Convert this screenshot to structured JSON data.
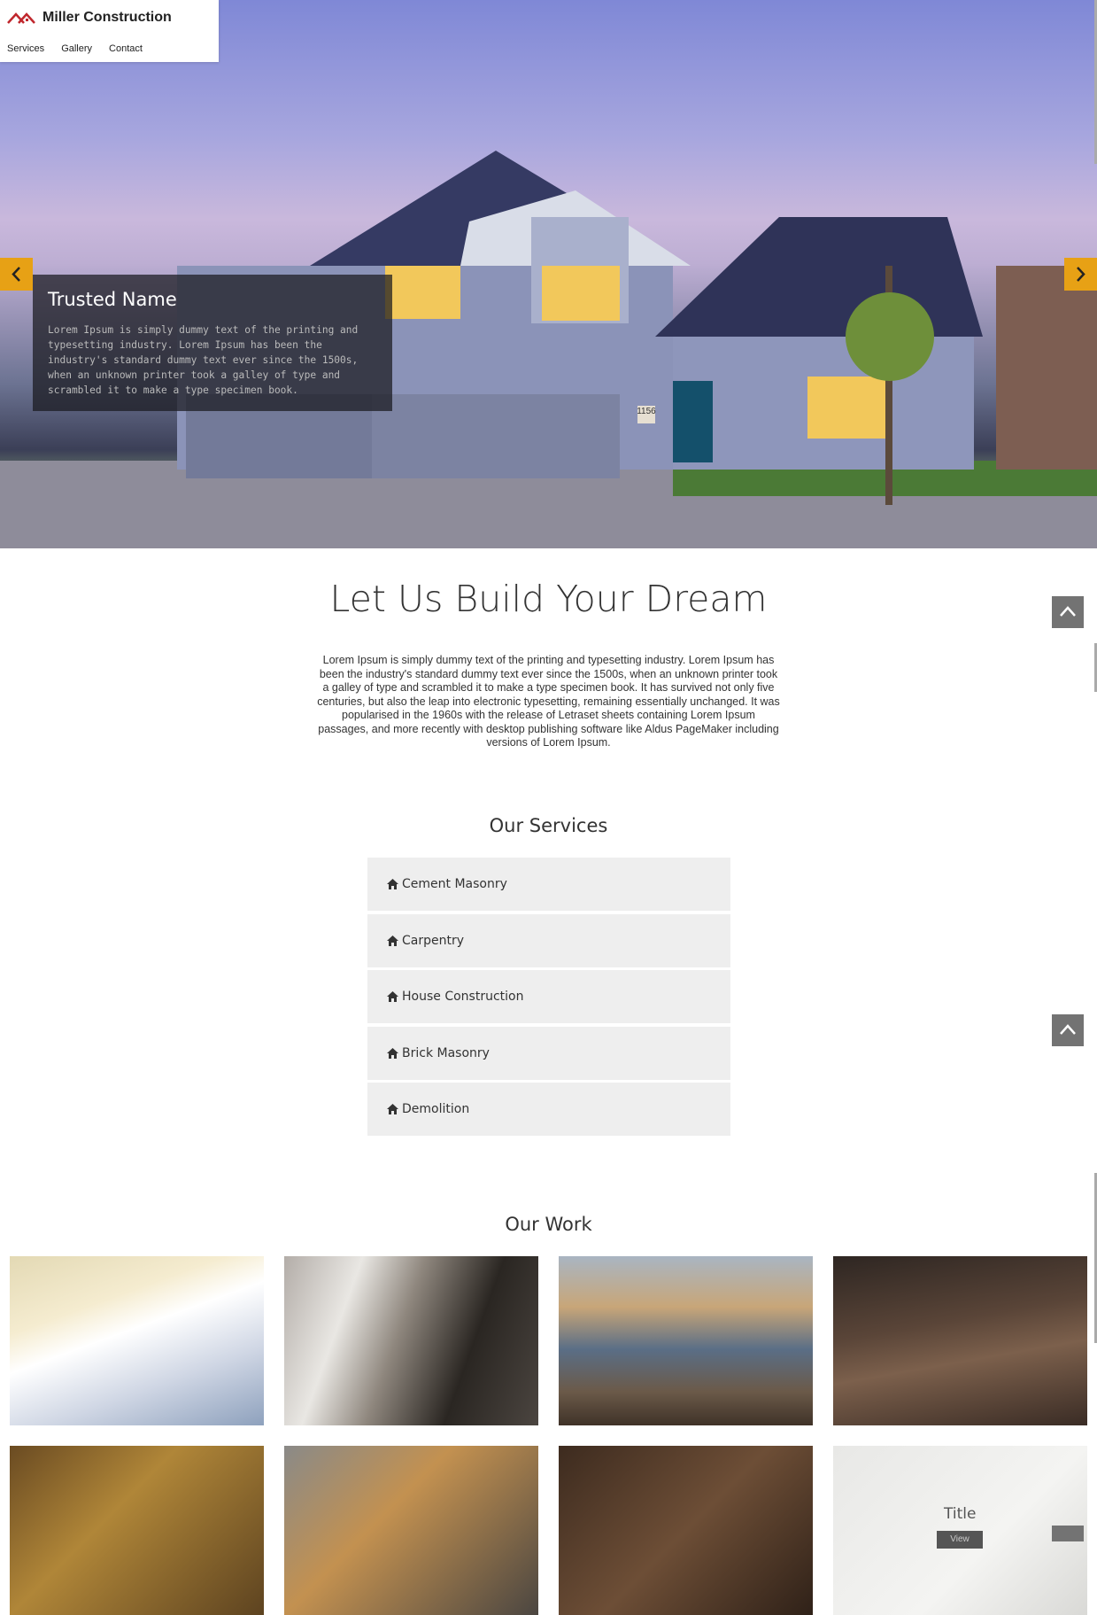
{
  "header": {
    "brand": "Miller Construction",
    "nav": [
      "Services",
      "Gallery",
      "Contact"
    ]
  },
  "hero": {
    "caption_title": "Trusted Name",
    "caption_text": "Lorem Ipsum is simply dummy text of the printing and typesetting industry. Lorem Ipsum has been the industry's standard dummy text ever since the 1500s, when an unknown printer took a galley of type and scrambled it to make a type specimen book.",
    "prev_icon": "chevron-left-icon",
    "next_icon": "chevron-right-icon",
    "house_number": "1156"
  },
  "intro": {
    "title": "Let Us Build Your Dream",
    "text": "Lorem Ipsum is simply dummy text of the printing and typesetting industry. Lorem Ipsum has been the industry's standard dummy text ever since the 1500s, when an unknown printer took a galley of type and scrambled it to make a type specimen book. It has survived not only five centuries, but also the leap into electronic typesetting, remaining essentially unchanged. It was popularised in the 1960s with the release of Letraset sheets containing Lorem Ipsum passages, and more recently with desktop publishing software like Aldus PageMaker including versions of Lorem Ipsum."
  },
  "services": {
    "title": "Our Services",
    "items": [
      "Cement Masonry",
      "Carpentry",
      "House Construction",
      "Brick Masonry",
      "Demolition"
    ],
    "icon": "home-icon"
  },
  "work": {
    "title": "Our Work",
    "overlay_title": "Title",
    "overlay_button": "View"
  },
  "colors": {
    "accent": "#e7a115",
    "caption_bg": "#19191e",
    "service_bg": "#eeeeee",
    "totop_bg": "#737373",
    "logo_red": "#c0272d"
  }
}
